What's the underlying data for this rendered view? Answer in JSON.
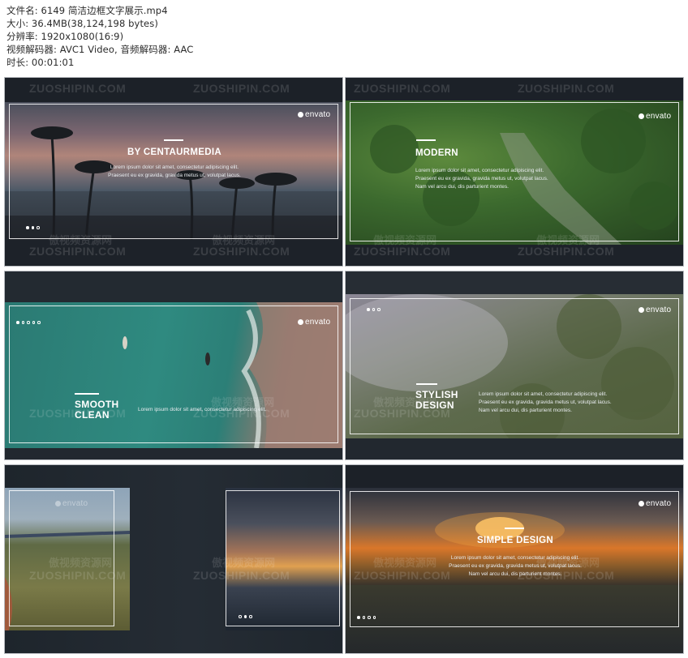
{
  "file_info": {
    "filename_line": "文件名: 6149 简洁边框文字展示.mp4",
    "size_line": "大小: 36.4MB(38,124,198 bytes)",
    "resolution_line": "分辨率: 1920x1080(16:9)",
    "codec_line": "视频解码器: AVC1 Video, 音频解码器: AAC",
    "duration_line": "时长: 00:01:01"
  },
  "watermark": {
    "en": "ZUOSHIPIN.COM",
    "cn": "傲视频资源网"
  },
  "brand": "envato",
  "lorem": {
    "l1": "Lorem ipsum dolor sit amet, consectetur adipiscing elit.",
    "l2": "Praesent eu ex gravida, gravida metus ut, volutpat lacus.",
    "l3": "Nam vel arcu dui,  dis parturient montes."
  },
  "thumbnails": [
    {
      "title": "BY CENTAURMEDIA"
    },
    {
      "title": "MODERN"
    },
    {
      "title_l1": "SMOOTH",
      "title_l2": "CLEAN"
    },
    {
      "title_l1": "STYLISH",
      "title_l2": "DESIGN"
    },
    {
      "title": ""
    },
    {
      "title": "SIMPLE DESIGN"
    }
  ],
  "colors": {
    "panel_bg": "#1f242b",
    "sea": "#2f8a80",
    "forest": "#3c6a2e",
    "sunset": "#d9772a"
  }
}
